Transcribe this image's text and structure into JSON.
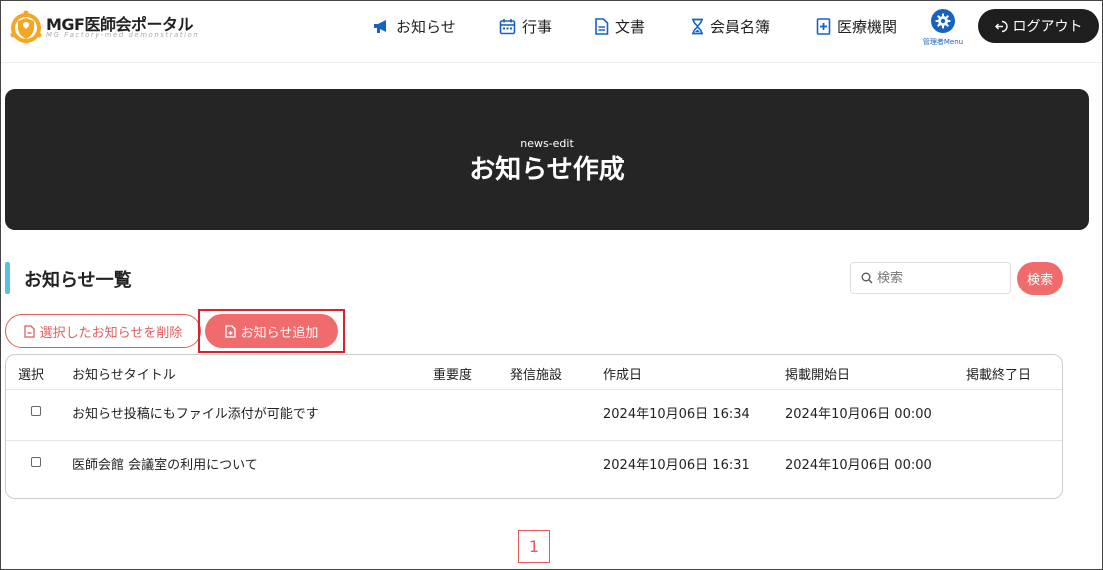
{
  "header": {
    "logo_title": "MGF医師会ポータル",
    "logo_subtitle": "MG Factory-med demonstration",
    "nav": [
      {
        "label": "お知らせ",
        "icon": "megaphone-icon"
      },
      {
        "label": "行事",
        "icon": "calendar-icon"
      },
      {
        "label": "文書",
        "icon": "document-icon"
      },
      {
        "label": "会員名簿",
        "icon": "hourglass-icon"
      },
      {
        "label": "医療機関",
        "icon": "hospital-icon"
      }
    ],
    "admin_label": "管理者Menu",
    "logout_label": "ログアウト"
  },
  "hero": {
    "subtitle": "news-edit",
    "title": "お知らせ作成"
  },
  "section": {
    "title": "お知らせ一覧",
    "search_placeholder": "検索",
    "search_button": "検索",
    "delete_button": "選択したお知らせを削除",
    "add_button": "お知らせ追加"
  },
  "table": {
    "columns": [
      "選択",
      "お知らせタイトル",
      "重要度",
      "発信施設",
      "作成日",
      "掲載開始日",
      "掲載終了日"
    ],
    "rows": [
      {
        "title": "お知らせ投稿にもファイル添付が可能です",
        "importance": "",
        "facility": "",
        "created": "2024年10月06日 16:34",
        "start": "2024年10月06日 00:00",
        "end": ""
      },
      {
        "title": "医師会館 会議室の利用について",
        "importance": "",
        "facility": "",
        "created": "2024年10月06日 16:31",
        "start": "2024年10月06日 00:00",
        "end": ""
      }
    ]
  },
  "pagination": {
    "current_page": "1"
  },
  "colors": {
    "accent": "#f06b6b",
    "nav_icon": "#1565c0",
    "hero_bg": "#252525",
    "section_bar": "#5bc0de",
    "highlight": "#d9222a"
  }
}
